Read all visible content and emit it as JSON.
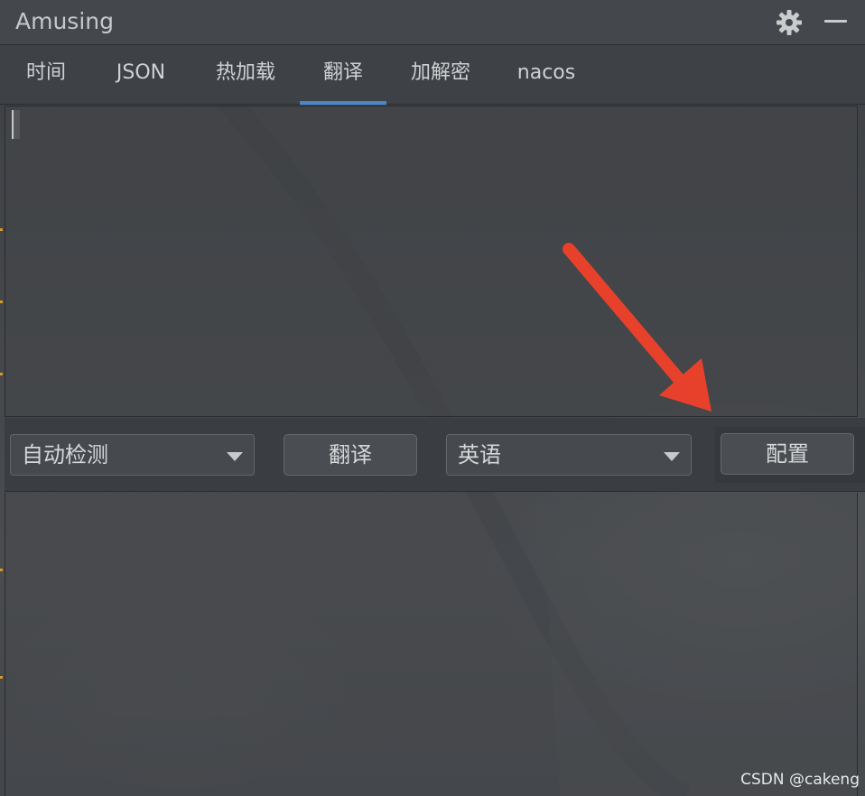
{
  "window": {
    "title": "Amusing",
    "actions": {
      "settings_icon": "gear-icon",
      "minimize_icon": "minimize-icon"
    }
  },
  "tabs": [
    {
      "label": "时间",
      "active": false
    },
    {
      "label": "JSON",
      "active": false
    },
    {
      "label": "热加载",
      "active": false
    },
    {
      "label": "翻译",
      "active": true
    },
    {
      "label": "加解密",
      "active": false
    },
    {
      "label": "nacos",
      "active": false
    }
  ],
  "translator": {
    "source_text": "",
    "source_language": "自动检测",
    "translate_button": "翻译",
    "target_language": "英语",
    "config_button": "配置",
    "result_text": ""
  },
  "annotation": {
    "arrow_color": "#e8412b",
    "points_to": "config-button"
  },
  "watermark": "CSDN @cakeng",
  "colors": {
    "accent": "#4a88c7",
    "window_bg": "#3f4246"
  }
}
